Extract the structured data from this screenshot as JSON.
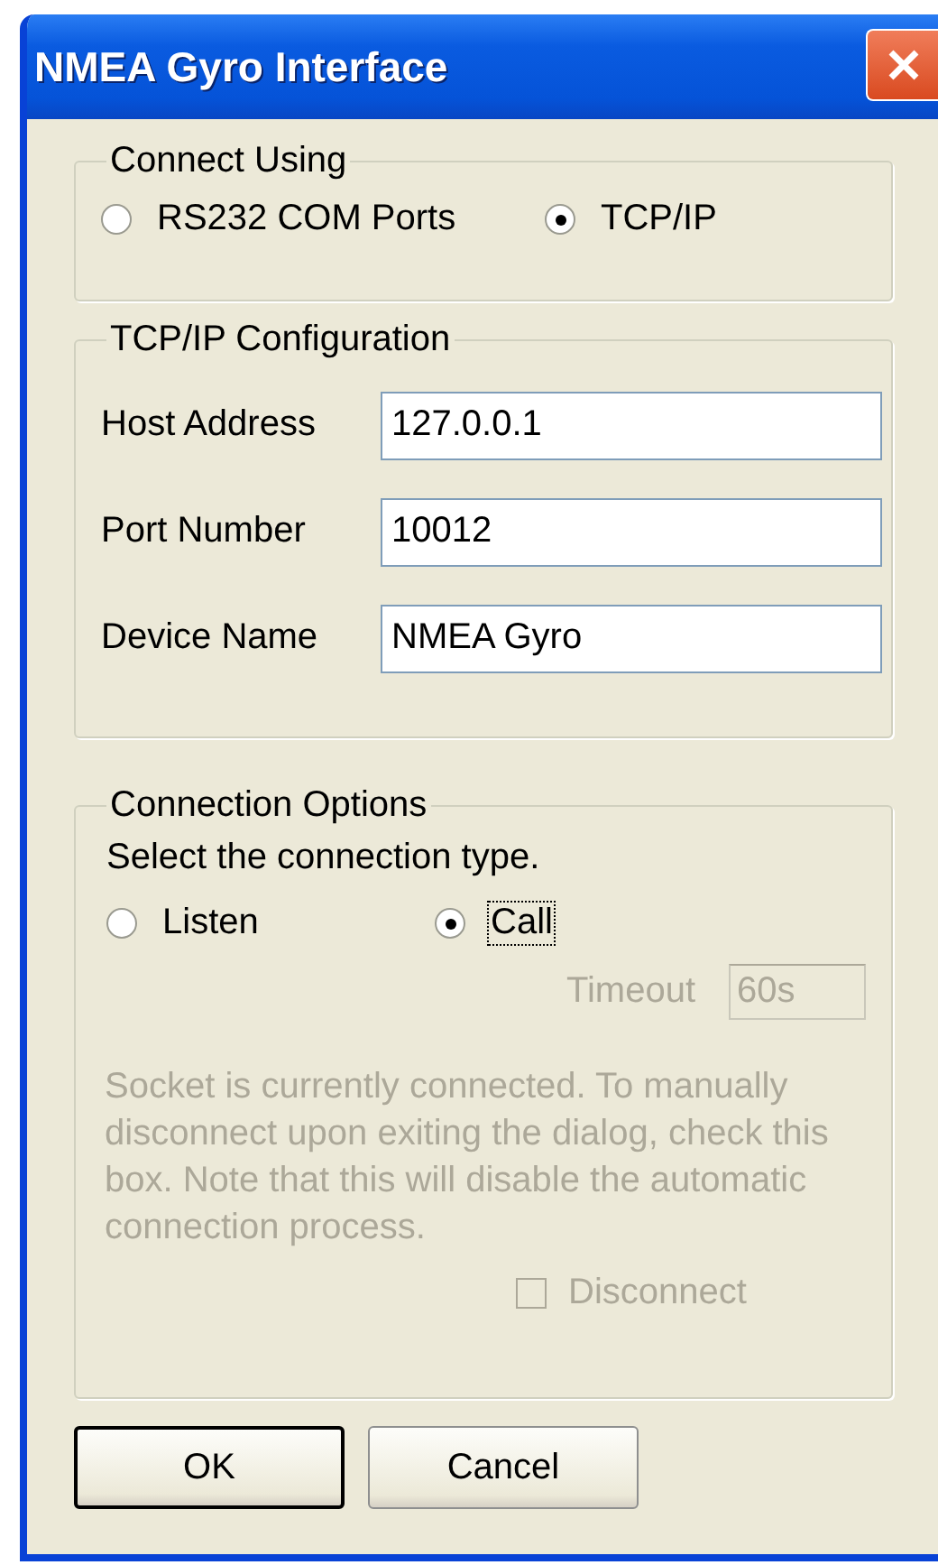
{
  "window": {
    "title": "NMEA Gyro Interface"
  },
  "connect_using": {
    "legend": "Connect Using",
    "options": [
      {
        "label": "RS232 COM Ports",
        "selected": false
      },
      {
        "label": "TCP/IP",
        "selected": true
      }
    ]
  },
  "tcpip_configuration": {
    "legend": "TCP/IP Configuration",
    "fields": [
      {
        "label": "Host Address",
        "value": "127.0.0.1"
      },
      {
        "label": "Port Number",
        "value": "10012"
      },
      {
        "label": "Device Name",
        "value": "NMEA Gyro"
      }
    ]
  },
  "connection_options": {
    "legend": "Connection Options",
    "prompt": "Select the connection type.",
    "types": [
      {
        "label": "Listen",
        "selected": false,
        "focused": false
      },
      {
        "label": "Call",
        "selected": true,
        "focused": true
      }
    ],
    "timeout": {
      "label": "Timeout",
      "value": "60s",
      "disabled": true
    },
    "note": "Socket is currently connected. To manually disconnect upon exiting the dialog, check this box. Note that this will disable the automatic connection process.",
    "disconnect": {
      "label": "Disconnect",
      "checked": false,
      "disabled": true
    }
  },
  "buttons": [
    {
      "label": "OK",
      "default": true
    },
    {
      "label": "Cancel",
      "default": false
    }
  ]
}
